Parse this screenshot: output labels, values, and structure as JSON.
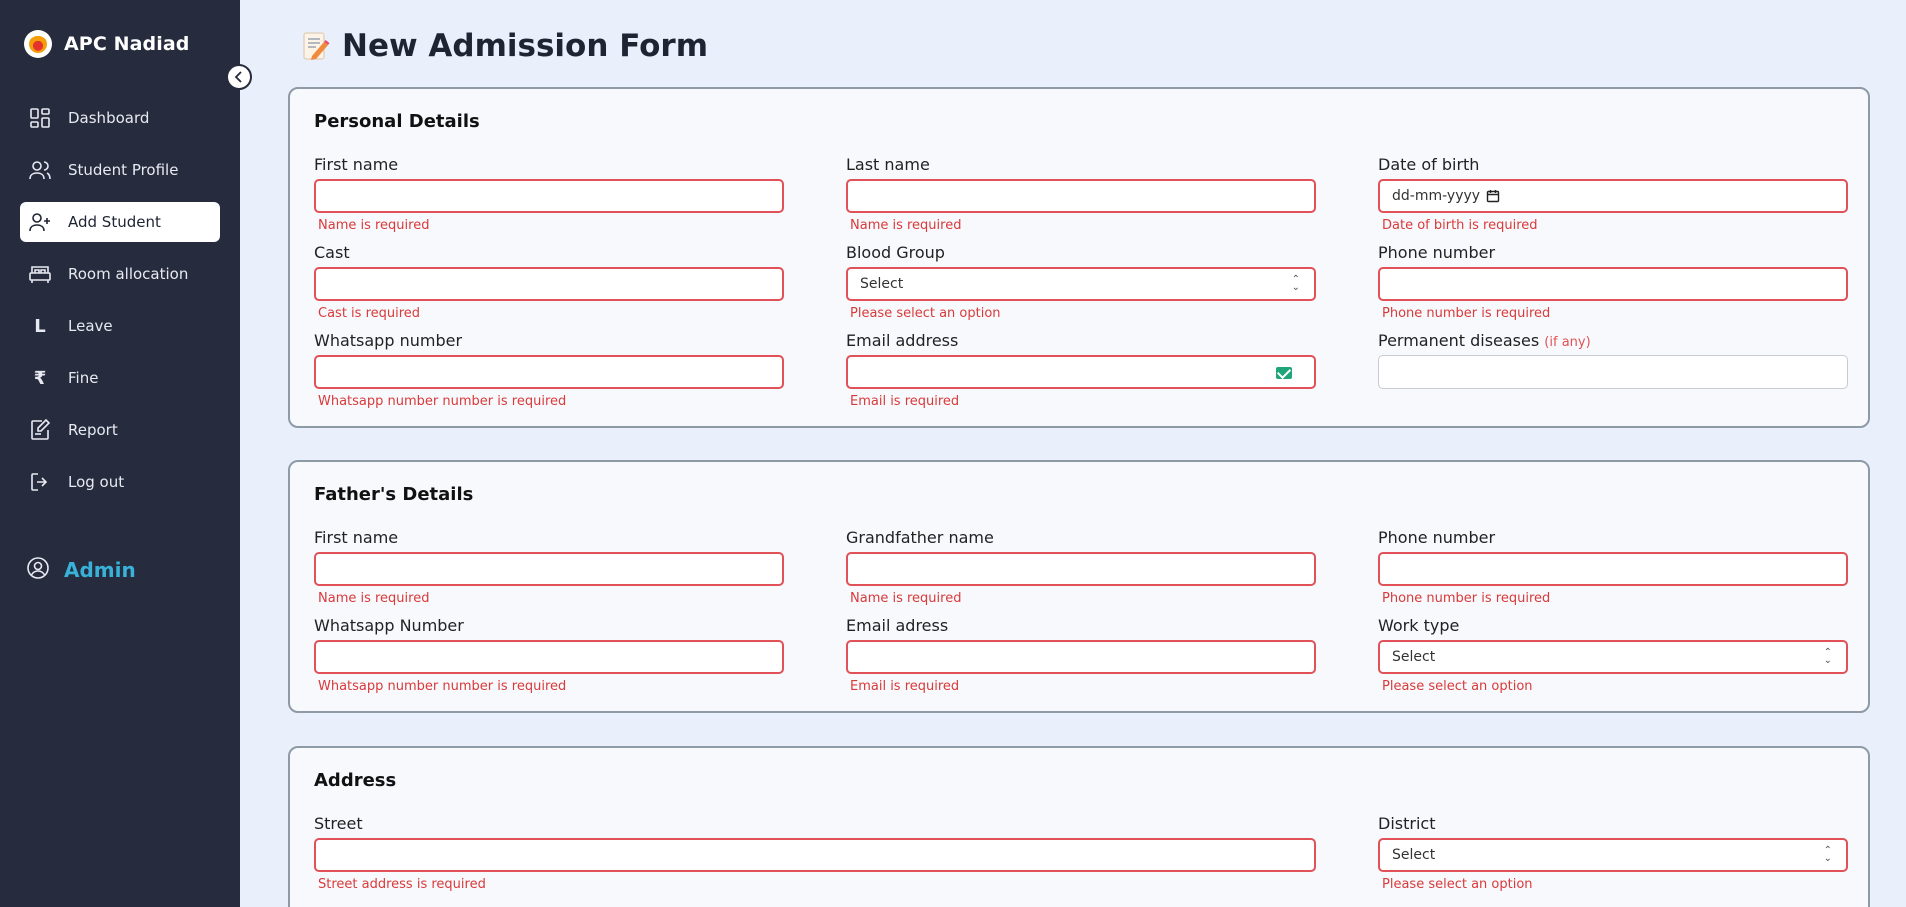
{
  "brand": {
    "name": "APC Nadiad"
  },
  "sidebar": {
    "items": [
      {
        "label": "Dashboard",
        "icon": "dashboard-icon"
      },
      {
        "label": "Student Profile",
        "icon": "users-icon"
      },
      {
        "label": "Add Student",
        "icon": "user-plus-icon",
        "active": true
      },
      {
        "label": "Room allocation",
        "icon": "bed-icon"
      },
      {
        "label": "Leave",
        "icon": "L"
      },
      {
        "label": "Fine",
        "icon": "₹"
      },
      {
        "label": "Report",
        "icon": "report-edit-icon"
      },
      {
        "label": "Log out",
        "icon": "logout-icon"
      }
    ],
    "user": "Admin"
  },
  "page": {
    "title": "New Admission Form"
  },
  "personal": {
    "title": "Personal Details",
    "first_name": {
      "label": "First name",
      "error": "Name is required"
    },
    "last_name": {
      "label": "Last name",
      "error": "Name is required"
    },
    "dob": {
      "label": "Date of birth",
      "placeholder": "dd-mm-yyyy",
      "error": "Date of birth is required"
    },
    "cast": {
      "label": "Cast",
      "error": "Cast is required"
    },
    "blood_group": {
      "label": "Blood Group",
      "value": "Select",
      "error": "Please select an option"
    },
    "phone": {
      "label": "Phone number",
      "error": "Phone number is required"
    },
    "whatsapp": {
      "label": "Whatsapp number",
      "error": "Whatsapp number number is required"
    },
    "email": {
      "label": "Email address",
      "error": "Email is required"
    },
    "diseases": {
      "label": "Permanent diseases",
      "hint": "(if any)"
    }
  },
  "father": {
    "title": "Father's Details",
    "first_name": {
      "label": "First name",
      "error": "Name is required"
    },
    "grandfather": {
      "label": "Grandfather name",
      "error": "Name is required"
    },
    "phone": {
      "label": "Phone number",
      "error": "Phone number is required"
    },
    "whatsapp": {
      "label": "Whatsapp Number",
      "error": "Whatsapp number number is required"
    },
    "email": {
      "label": "Email adress",
      "error": "Email is required"
    },
    "work_type": {
      "label": "Work type",
      "value": "Select",
      "error": "Please select an option"
    }
  },
  "address": {
    "title": "Address",
    "street": {
      "label": "Street",
      "error": "Street address is required"
    },
    "district": {
      "label": "District",
      "value": "Select",
      "error": "Please select an option"
    }
  },
  "colors": {
    "sidebar": "#262b3d",
    "error": "#e05257",
    "accent": "#38b2d8"
  }
}
